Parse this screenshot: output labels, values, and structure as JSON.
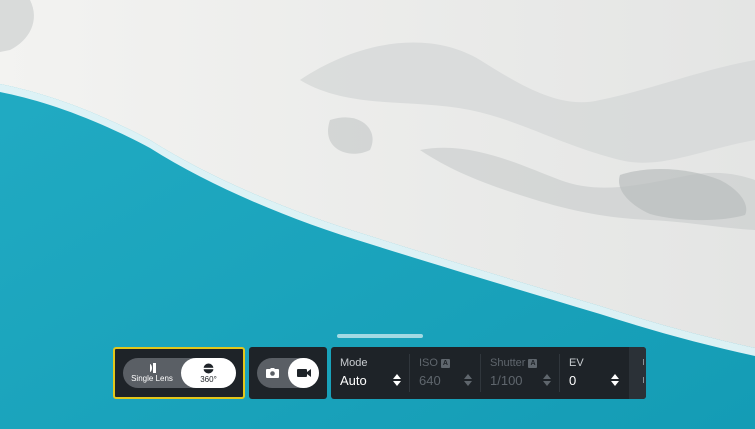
{
  "lens_selector": {
    "options": [
      {
        "label": "Single Lens",
        "icon": "single-lens-icon",
        "selected": false
      },
      {
        "label": "360°",
        "icon": "360-lens-icon",
        "selected": true
      }
    ],
    "focus_color": "#e2c71b"
  },
  "capture_mode": {
    "options": [
      {
        "icon": "camera-icon",
        "selected": false
      },
      {
        "icon": "video-camera-icon",
        "selected": true
      }
    ]
  },
  "settings": [
    {
      "label": "Mode",
      "value": "Auto",
      "auto_badge": "",
      "enabled": true
    },
    {
      "label": "ISO",
      "value": "640",
      "auto_badge": "A",
      "enabled": false
    },
    {
      "label": "Shutter",
      "value": "1/100",
      "auto_badge": "A",
      "enabled": false
    },
    {
      "label": "EV",
      "value": "0",
      "auto_badge": "",
      "enabled": true
    }
  ],
  "colors": {
    "panel_bg": "#1e2328",
    "water": "#1aa7bf",
    "snow": "#f1f0ee"
  }
}
